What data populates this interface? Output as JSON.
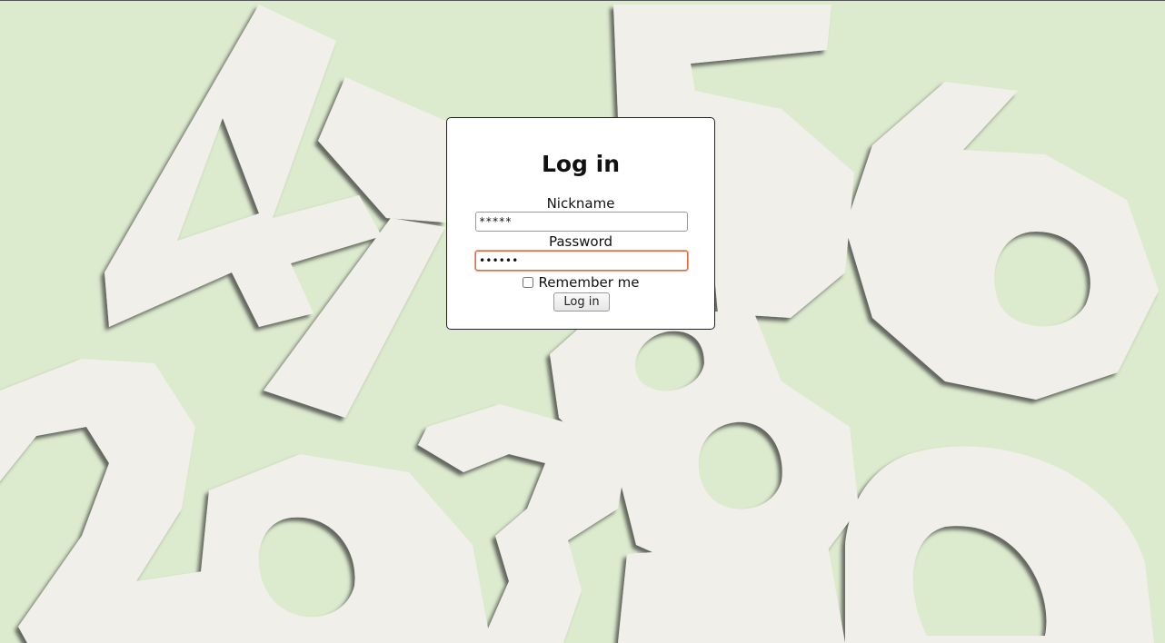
{
  "background": {
    "image": "wooden-numbers-background",
    "color": "#dcebcd"
  },
  "login": {
    "title": "Log in",
    "nickname_label": "Nickname",
    "nickname_value": "*****",
    "password_label": "Password",
    "password_value": "••••••",
    "remember_label": "Remember me",
    "remember_checked": false,
    "button_label": "Log in"
  },
  "colors": {
    "focus_border": "#e06a3b",
    "box_bg": "#ffffff"
  }
}
